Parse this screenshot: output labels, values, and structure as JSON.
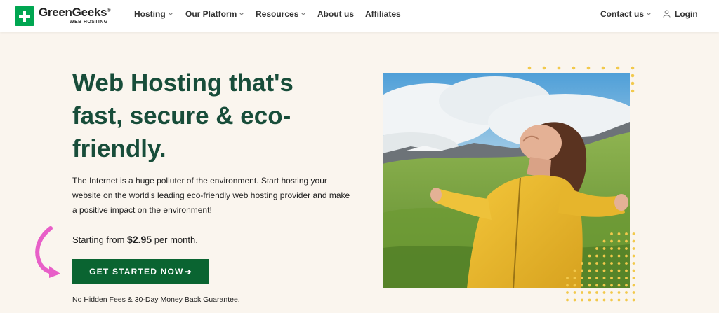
{
  "logo": {
    "name": "GreenGeeks",
    "reg": "®",
    "sub": "WEB HOSTING"
  },
  "nav": {
    "hosting": "Hosting",
    "platform": "Our Platform",
    "resources": "Resources",
    "about": "About us",
    "affiliates": "Affiliates",
    "contact": "Contact us",
    "login": "Login"
  },
  "hero": {
    "title_1": "Web Hosting that's",
    "title_2": "fast, secure & eco-",
    "title_3": "friendly.",
    "desc_1": "The Internet is a huge polluter of the environment. Start hosting your",
    "desc_2": "website on the world's leading eco-friendly web hosting provider and make",
    "desc_3": "a positive impact on the environment!",
    "price_prefix": "Starting from ",
    "price": "$2.95",
    "price_suffix": " per month.",
    "cta": "GET STARTED NOW",
    "cta_arrow": "➔",
    "guarantee": "No Hidden Fees & 30-Day Money Back Guarantee."
  },
  "colors": {
    "brand_green": "#00a651",
    "title_green": "#184d3a",
    "cta_green": "#0a6431",
    "accent_pink": "#e85fc8",
    "dot_yellow": "#f2c94c",
    "background": "#faf5ee"
  },
  "icons": {
    "logo": "plus-logo-icon",
    "user": "user-icon",
    "chevron": "chevron-down-icon",
    "arrow": "curved-arrow-icon"
  }
}
